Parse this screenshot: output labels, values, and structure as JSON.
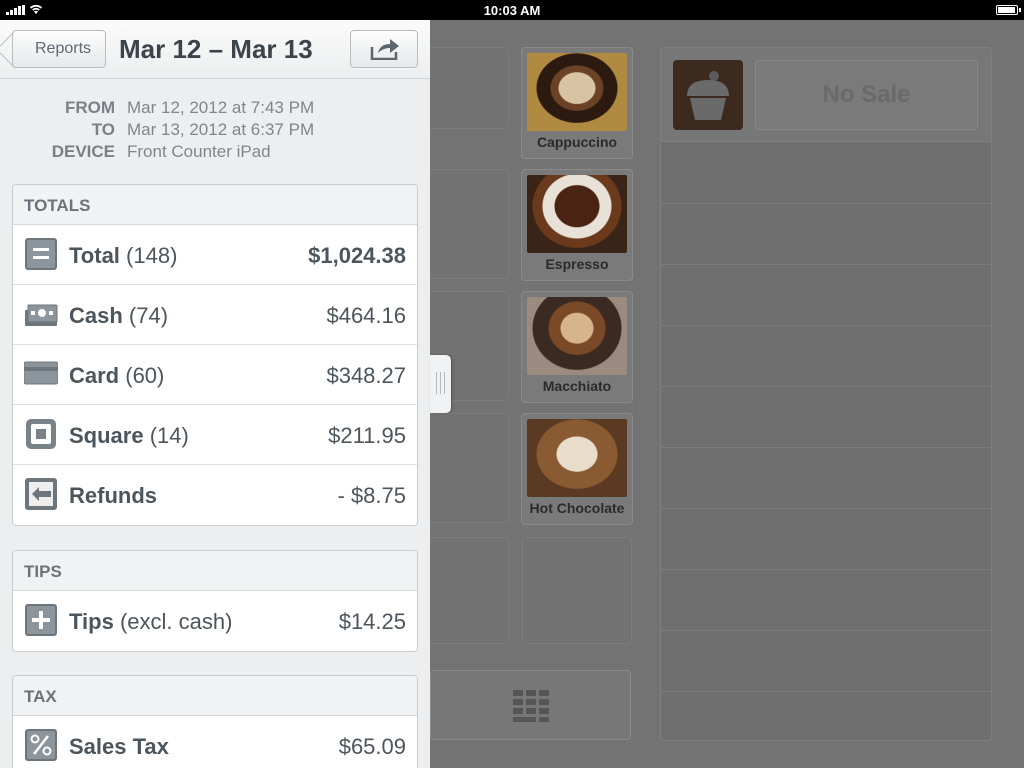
{
  "status_bar": {
    "time": "10:03 AM"
  },
  "register": {
    "items": [
      {
        "label": "Cappuccino"
      },
      {
        "label": "Espresso"
      },
      {
        "label": "Macchiato"
      },
      {
        "label": "Hot Chocolate"
      }
    ],
    "no_sale_label": "No Sale"
  },
  "reports": {
    "back_label": "Reports",
    "title": "Mar 12 – Mar 13",
    "meta": {
      "from_key": "FROM",
      "from_value": "Mar 12, 2012 at 7:43 PM",
      "to_key": "TO",
      "to_value": "Mar 13, 2012 at 6:37 PM",
      "device_key": "DEVICE",
      "device_value": "Front Counter iPad"
    },
    "totals": {
      "header": "TOTALS",
      "rows": [
        {
          "name": "Total",
          "count": "(148)",
          "amount": "$1,024.38",
          "icon": "total-icon"
        },
        {
          "name": "Cash",
          "count": "(74)",
          "amount": "$464.16",
          "icon": "cash-icon"
        },
        {
          "name": "Card",
          "count": "(60)",
          "amount": "$348.27",
          "icon": "card-icon"
        },
        {
          "name": "Square",
          "count": "(14)",
          "amount": "$211.95",
          "icon": "square-icon"
        },
        {
          "name": "Refunds",
          "count": "",
          "amount": "- $8.75",
          "icon": "refund-icon"
        }
      ]
    },
    "tips": {
      "header": "TIPS",
      "rows": [
        {
          "name": "Tips",
          "count": "(excl. cash)",
          "amount": "$14.25",
          "icon": "plus-icon"
        }
      ]
    },
    "tax": {
      "header": "TAX",
      "rows": [
        {
          "name": "Sales Tax",
          "count": "",
          "amount": "$65.09",
          "icon": "percent-icon"
        }
      ]
    }
  },
  "colors": {
    "panel_bg": "#eceeef",
    "text": "#4d555c",
    "dim_overlay": "#737373"
  }
}
